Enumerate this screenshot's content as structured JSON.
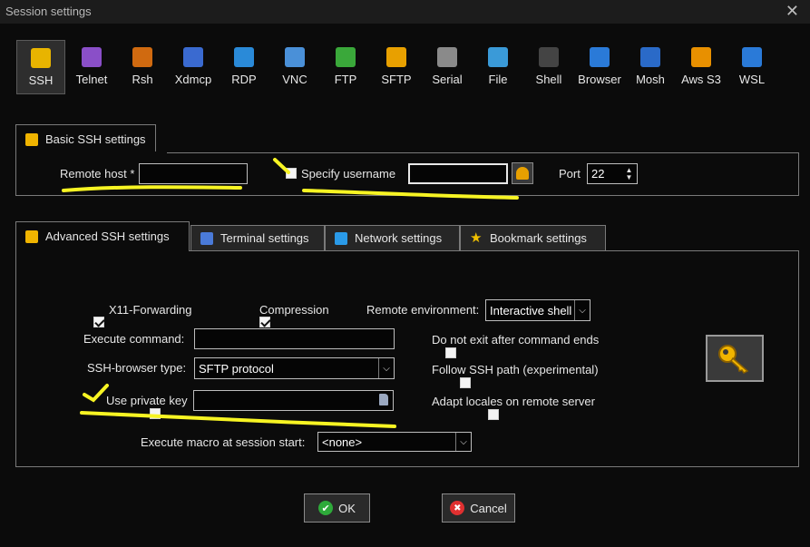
{
  "window": {
    "title": "Session settings",
    "close_glyph": "✕"
  },
  "session_types": [
    {
      "label": "SSH",
      "icon": "ssh-key-icon",
      "color": "#e8b400"
    },
    {
      "label": "Telnet",
      "icon": "telnet-icon",
      "color": "#8a4fc8"
    },
    {
      "label": "Rsh",
      "icon": "rsh-icon",
      "color": "#d06a10"
    },
    {
      "label": "Xdmcp",
      "icon": "xdmcp-icon",
      "color": "#3a6ad0"
    },
    {
      "label": "RDP",
      "icon": "rdp-icon",
      "color": "#2a8ad8"
    },
    {
      "label": "VNC",
      "icon": "vnc-icon",
      "color": "#4a90d8"
    },
    {
      "label": "FTP",
      "icon": "ftp-icon",
      "color": "#3aa83a"
    },
    {
      "label": "SFTP",
      "icon": "sftp-icon",
      "color": "#e8a000"
    },
    {
      "label": "Serial",
      "icon": "serial-icon",
      "color": "#8a8a8a"
    },
    {
      "label": "File",
      "icon": "file-icon",
      "color": "#3a9ad8"
    },
    {
      "label": "Shell",
      "icon": "shell-icon",
      "color": "#444444"
    },
    {
      "label": "Browser",
      "icon": "browser-icon",
      "color": "#2a7ad8"
    },
    {
      "label": "Mosh",
      "icon": "mosh-icon",
      "color": "#2a6ac8"
    },
    {
      "label": "Aws S3",
      "icon": "aws-s3-icon",
      "color": "#e89000"
    },
    {
      "label": "WSL",
      "icon": "wsl-icon",
      "color": "#2a7ad8"
    }
  ],
  "basic": {
    "tab_label": "Basic SSH settings",
    "remote_host_label": "Remote host *",
    "remote_host_value": "",
    "specify_username_label": "Specify username",
    "specify_username_checked": false,
    "username_value": "",
    "port_label": "Port",
    "port_value": "22"
  },
  "tabs": [
    {
      "label": "Advanced SSH settings",
      "icon": "wrench-icon",
      "selected": true
    },
    {
      "label": "Terminal settings",
      "icon": "terminal-icon",
      "selected": false
    },
    {
      "label": "Network settings",
      "icon": "network-icon",
      "selected": false
    },
    {
      "label": "Bookmark settings",
      "icon": "star-icon",
      "selected": false
    }
  ],
  "advanced": {
    "x11_label": "X11-Forwarding",
    "x11_checked": true,
    "compression_label": "Compression",
    "compression_checked": true,
    "remote_env_label": "Remote environment:",
    "remote_env_value": "Interactive shell",
    "execute_command_label": "Execute command:",
    "execute_command_value": "",
    "do_not_exit_label": "Do not exit after command ends",
    "do_not_exit_checked": false,
    "browser_type_label": "SSH-browser type:",
    "browser_type_value": "SFTP protocol",
    "follow_ssh_path_label": "Follow SSH path (experimental)",
    "follow_ssh_path_checked": false,
    "private_key_label": "Use private key",
    "private_key_checked": false,
    "private_key_value": "",
    "adapt_locales_label": "Adapt locales on remote server",
    "adapt_locales_checked": false,
    "macro_label": "Execute macro at session start:",
    "macro_value": "<none>"
  },
  "buttons": {
    "ok": "OK",
    "cancel": "Cancel"
  },
  "colors": {
    "highlight": "#f7f423",
    "accent_key": "#f0b400",
    "ok_green": "#2eaa3a",
    "cancel_red": "#e03030"
  }
}
